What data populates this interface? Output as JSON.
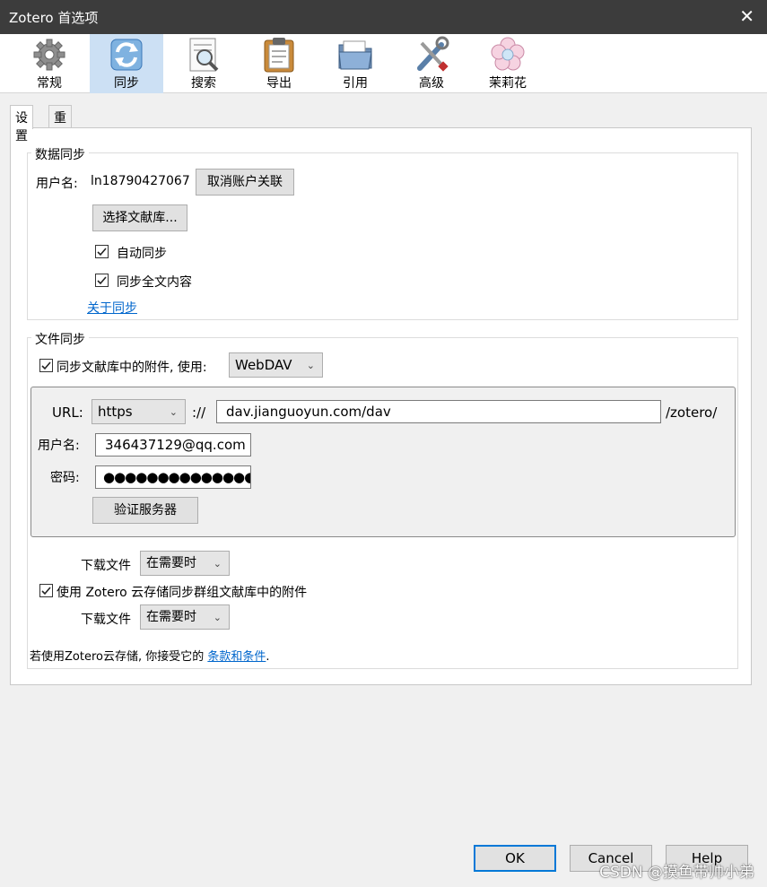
{
  "window": {
    "title": "Zotero 首选项",
    "close_glyph": "✕"
  },
  "toolbar": {
    "items": [
      {
        "label": "常规",
        "icon": "gear-icon",
        "selected": false
      },
      {
        "label": "同步",
        "icon": "sync-icon",
        "selected": true
      },
      {
        "label": "搜索",
        "icon": "search-document-icon",
        "selected": false
      },
      {
        "label": "导出",
        "icon": "clipboard-icon",
        "selected": false
      },
      {
        "label": "引用",
        "icon": "folder-icon",
        "selected": false
      },
      {
        "label": "高级",
        "icon": "tools-icon",
        "selected": false
      },
      {
        "label": "茉莉花",
        "icon": "flower-icon",
        "selected": false
      }
    ]
  },
  "tabs": [
    {
      "label": "设置",
      "active": true
    },
    {
      "label": "重置",
      "active": false
    }
  ],
  "data_sync": {
    "caption": "数据同步",
    "username_label": "用户名:",
    "username_value": "ln18790427067",
    "unlink_button": "取消账户关联",
    "choose_libraries_button": "选择文献库...",
    "auto_sync_label": "自动同步",
    "auto_sync_checked": true,
    "fulltext_sync_label": "同步全文内容",
    "fulltext_sync_checked": true,
    "about_link": "关于同步"
  },
  "file_sync": {
    "caption": "文件同步",
    "sync_attachments_label": "同步文献库中的附件, 使用:",
    "sync_attachments_checked": true,
    "protocol_select": "WebDAV",
    "url_label": "URL:",
    "scheme_select": "https",
    "scheme_sep": "://",
    "url_value": "dav.jianguoyun.com/dav",
    "url_suffix": "/zotero/",
    "username_label": "用户名:",
    "username_value": "346437129@qq.com",
    "password_label": "密码:",
    "password_value": "●●●●●●●●●●●●●●●●",
    "verify_button": "验证服务器",
    "download_label_1": "下载文件",
    "download_select_1": "在需要时",
    "group_sync_label": "使用 Zotero 云存储同步群组文献库中的附件",
    "group_sync_checked": true,
    "download_label_2": "下载文件",
    "download_select_2": "在需要时",
    "terms_text": "若使用Zotero云存储, 你接受它的",
    "terms_link": "条款和条件",
    "terms_period": "."
  },
  "footer": {
    "ok": "OK",
    "cancel": "Cancel",
    "help": "Help"
  },
  "watermark": "CSDN @摸鱼带帅小弟",
  "colors": {
    "accent": "#0078d7",
    "selected_tab": "#cce0f4",
    "link": "#0066cc",
    "titlebar": "#3c3c3c"
  }
}
